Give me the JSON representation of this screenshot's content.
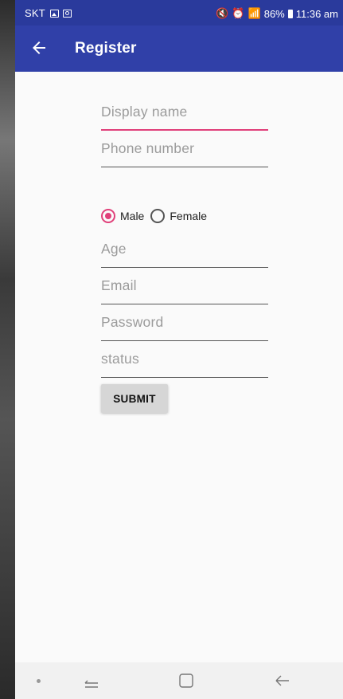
{
  "status_bar": {
    "carrier": "SKT",
    "notification_icons": [
      "gallery-icon",
      "camera-icon"
    ],
    "right_icons": [
      "mute-icon",
      "alarm-icon",
      "wifi-icon",
      "signal-icon"
    ],
    "battery": "86%",
    "time": "11:36 am"
  },
  "app_bar": {
    "title": "Register",
    "back_icon": "back-arrow-icon"
  },
  "form": {
    "display_name": {
      "placeholder": "Display name",
      "value": ""
    },
    "phone_number": {
      "placeholder": "Phone number",
      "value": ""
    },
    "gender": {
      "options": [
        "Male",
        "Female"
      ],
      "selected": "Male"
    },
    "age": {
      "placeholder": "Age",
      "value": ""
    },
    "email": {
      "placeholder": "Email",
      "value": ""
    },
    "password": {
      "placeholder": "Password",
      "value": ""
    },
    "status": {
      "placeholder": "status",
      "value": ""
    },
    "submit_label": "SUBMIT"
  },
  "colors": {
    "status_bar": "#2a3a9c",
    "app_bar": "#3040a8",
    "accent": "#e0407a",
    "background": "#fafafa",
    "button": "#d6d6d6"
  },
  "nav_bar": {
    "icons": [
      "dot-icon",
      "recent-apps-icon",
      "home-icon",
      "back-icon"
    ]
  }
}
